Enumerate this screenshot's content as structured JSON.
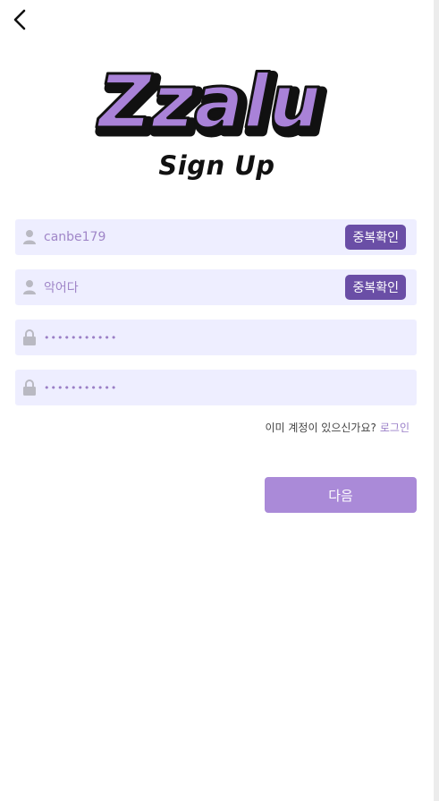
{
  "brand": {
    "logo_text": "Zzalu",
    "subtitle": "Sign Up",
    "accent": "#aa8ad8",
    "dark_accent": "#6a4ea6",
    "field_bg": "#eeeeff"
  },
  "form": {
    "id_field": {
      "value": "canbe179",
      "check_label": "중복확인"
    },
    "nickname_field": {
      "value": "악어다",
      "check_label": "중복확인"
    },
    "password_field": {
      "value": "•••••••••••"
    },
    "password_confirm_field": {
      "value": "•••••••••••"
    }
  },
  "login_prompt": {
    "text": "이미 계정이 있으신가요?",
    "link": "로그인"
  },
  "next_button": {
    "label": "다음"
  }
}
